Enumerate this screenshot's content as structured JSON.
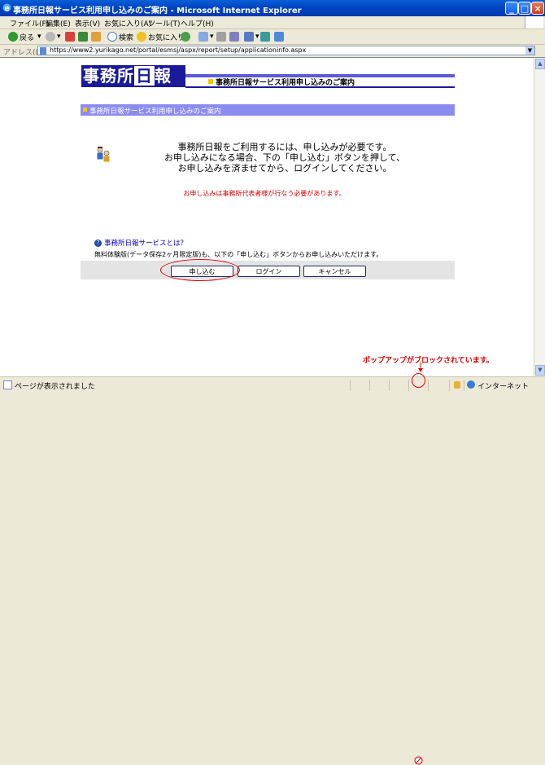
{
  "window": {
    "title": "事務所日報サービス利用申し込みのご案内 - Microsoft Internet Explorer"
  },
  "menu": [
    "ファイル(F)",
    "編集(E)",
    "表示(V)",
    "お気に入り(A)",
    "ツール(T)",
    "ヘルプ(H)"
  ],
  "toolbar": {
    "back": "戻る",
    "search": "検索",
    "favorites": "お気に入り"
  },
  "address": {
    "label": "アドレス(D)",
    "url": "https://www2.yurikago.net/portal/esmsj/aspx/report/setup/applicationinfo.aspx"
  },
  "page": {
    "logo_a": "事務所",
    "logo_b": "日",
    "logo_c": "報",
    "header_caption": "事務所日報サービス利用申し込みのご案内",
    "section_title": "事務所日報サービス利用申し込みのご案内",
    "message_lines": [
      "事務所日報をご利用するには、申し込みが必要です。",
      "お申し込みになる場合、下の「申し込む」ボタンを押して、",
      "お申し込みを済ませてから、ログインしてください。"
    ],
    "notice": "お申し込みは事務所代表者様が行なう必要があります。",
    "service_link": "事務所日報サービスとは？",
    "free_text": "無料体験版(データ保存2ヶ月限定版)も、以下の「申し込む」ボタンからお申し込みいただけます。",
    "buttons": {
      "apply": "申し込む",
      "login": "ログイン",
      "cancel": "キャンセル"
    }
  },
  "annotation": {
    "popup_blocked": "ポップアップがブロックされています。"
  },
  "status": {
    "text": "ページが表示されました",
    "zone": "インターネット"
  },
  "colors": {
    "title_blue": "#0047c4",
    "logo_navy": "#1a1a9a",
    "section_purple": "#8c8cf0",
    "annotation_red": "#e00000"
  }
}
